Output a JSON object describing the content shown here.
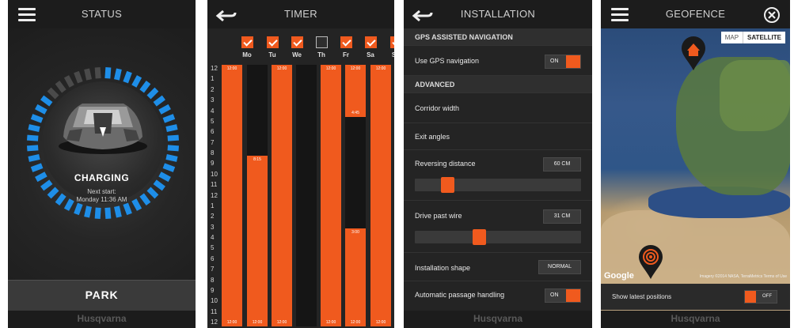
{
  "status": {
    "title": "STATUS",
    "state": "CHARGING",
    "next_label": "Next start:",
    "next_time": "Monday 11:36 AM",
    "park_label": "PARK",
    "brand": "Husqvarna",
    "charge_level": 0.85
  },
  "timer": {
    "title": "TIMER",
    "days": [
      {
        "name": "Mo",
        "checked": true
      },
      {
        "name": "Tu",
        "checked": true
      },
      {
        "name": "We",
        "checked": true
      },
      {
        "name": "Th",
        "checked": false
      },
      {
        "name": "Fr",
        "checked": true
      },
      {
        "name": "Sa",
        "checked": true
      },
      {
        "name": "Su",
        "checked": true
      }
    ],
    "hour_labels": [
      "12",
      "1",
      "2",
      "3",
      "4",
      "5",
      "6",
      "7",
      "8",
      "9",
      "10",
      "11",
      "12",
      "1",
      "2",
      "3",
      "4",
      "5",
      "6",
      "7",
      "8",
      "9",
      "10",
      "11",
      "12"
    ],
    "brand": "Husqvarna"
  },
  "installation": {
    "title": "INSTALLATION",
    "gps_section": "GPS ASSISTED NAVIGATION",
    "use_gps_label": "Use GPS navigation",
    "use_gps_value": "ON",
    "advanced_section": "ADVANCED",
    "corridor_label": "Corridor width",
    "exit_angles_label": "Exit angles",
    "reversing_label": "Reversing distance",
    "reversing_value": "60 CM",
    "reversing_fraction": 0.17,
    "drive_past_label": "Drive past wire",
    "drive_past_value": "31 CM",
    "drive_past_fraction": 0.38,
    "shape_label": "Installation shape",
    "shape_value": "NORMAL",
    "passage_label": "Automatic passage handling",
    "passage_value": "ON",
    "brand": "Husqvarna"
  },
  "geofence": {
    "title": "GEOFENCE",
    "map_btn": "MAP",
    "satellite_btn": "SATELLITE",
    "google": "Google",
    "credit": "Imagery ©2014 NASA, TerraMetrics   Terms of Use",
    "latest_label": "Show latest positions",
    "latest_value": "OFF",
    "brand": "Husqvarna"
  },
  "colors": {
    "accent": "#f05a1e",
    "ring_blue": "#1e8ee8",
    "background": "#242424"
  }
}
